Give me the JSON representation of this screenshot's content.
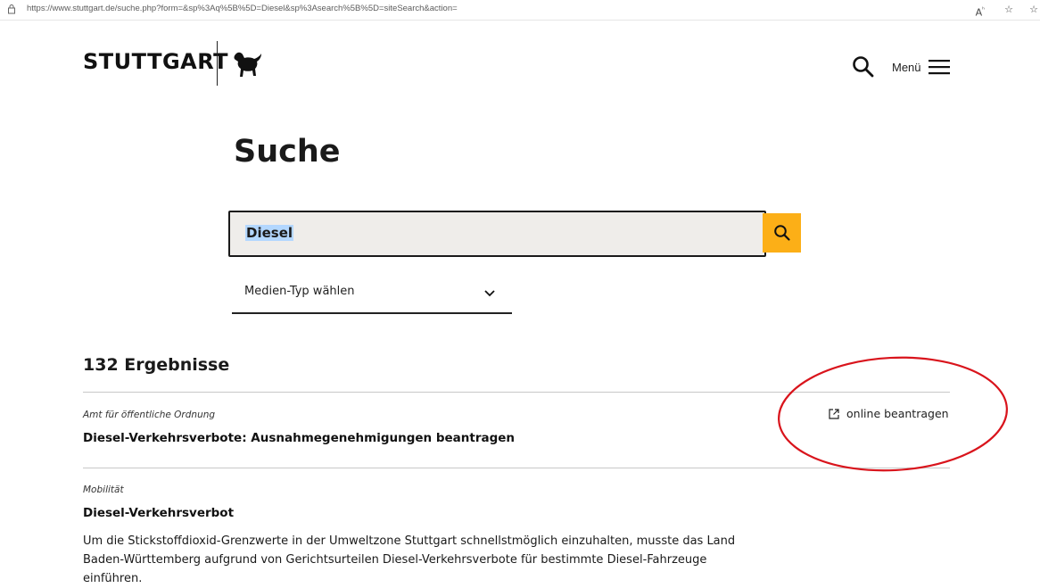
{
  "browser": {
    "url": "https://www.stuttgart.de/suche.php?form=&sp%3Aq%5B%5D=Diesel&sp%3Asearch%5B%5D=siteSearch&action=",
    "url_domain": "www.stuttgart.de",
    "read_aloud_icon": "read-aloud-icon",
    "favorite_icon": "favorite-icon",
    "collections_icon": "collections-icon"
  },
  "header": {
    "logo_text": "STUTTGART",
    "menu_label": "Menü"
  },
  "page": {
    "title": "Suche"
  },
  "search": {
    "value": "Diesel"
  },
  "filter": {
    "medien_typ_label": "Medien-Typ wählen"
  },
  "results": {
    "count_label": "132 Ergebnisse",
    "items": [
      {
        "category": "Amt für öffentliche Ordnung",
        "title": "Diesel-Verkehrsverbote: Ausnahmegenehmigungen beantragen",
        "action_label": "online beantragen"
      },
      {
        "category": "Mobilität",
        "title": "Diesel-Verkehrsverbot",
        "text_line1": "Um die Stickstoffdioxid-Grenzwerte in der Umweltzone Stuttgart schnellstmöglich einzuhalten, musste das Land",
        "text_line2": "Baden-Württemberg aufgrund von Gerichtsurteilen Diesel-Verkehrsverbote für bestimmte Diesel-Fahrzeuge einführen."
      }
    ]
  },
  "colors": {
    "accent_yellow": "#fcaf17",
    "annotation_red": "#d9141c",
    "search_bg": "#efedea",
    "selection_blue": "#b3d7ff"
  }
}
